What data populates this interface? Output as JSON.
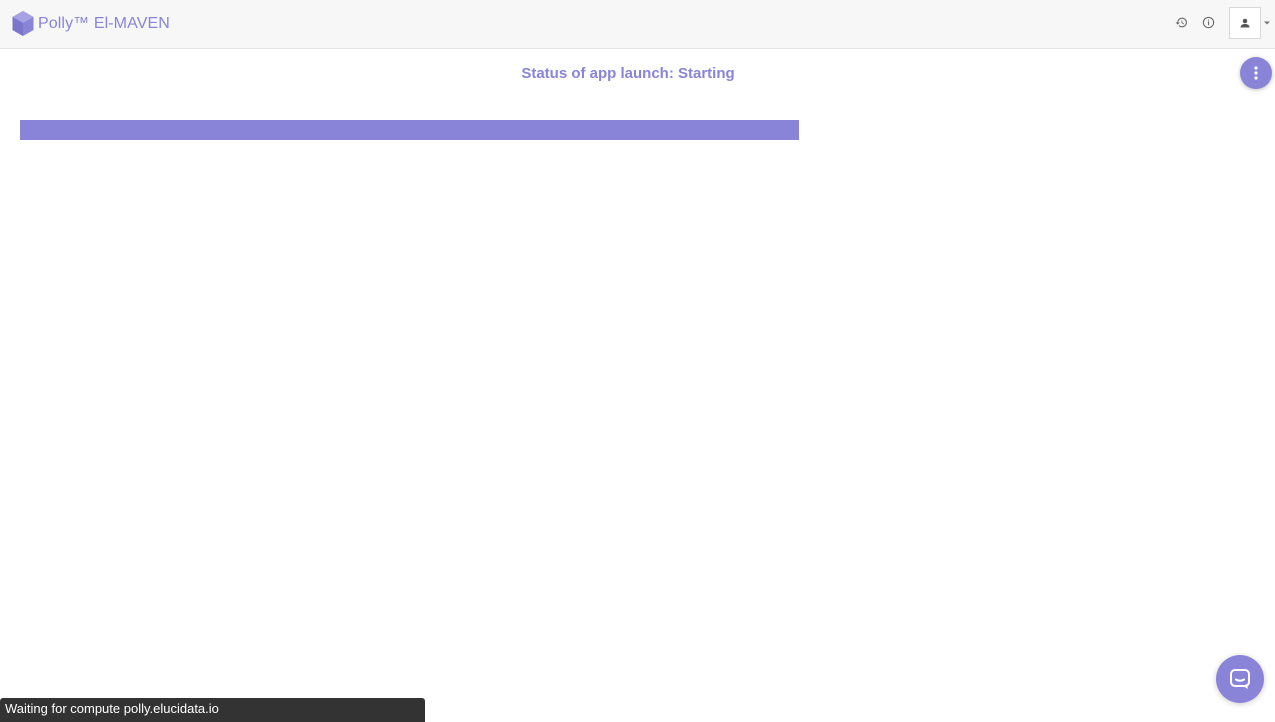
{
  "header": {
    "brand_name": "Polly™ El-MAVEN",
    "icons": [
      "polly-logo-icon",
      "history-icon",
      "info-icon",
      "user-icon",
      "caret-down-icon"
    ]
  },
  "main": {
    "status_text": "Status of app launch: Starting",
    "progress_fraction": 1.0,
    "menu_icon": "kebab-menu-icon"
  },
  "toast": {
    "text": "Waiting for compute polly.elucidata.io"
  },
  "chat": {
    "icon": "chat-icon"
  },
  "colors": {
    "accent": "#8a84d8",
    "topbar_bg": "#f7f7f7",
    "toast_bg": "#333333"
  }
}
